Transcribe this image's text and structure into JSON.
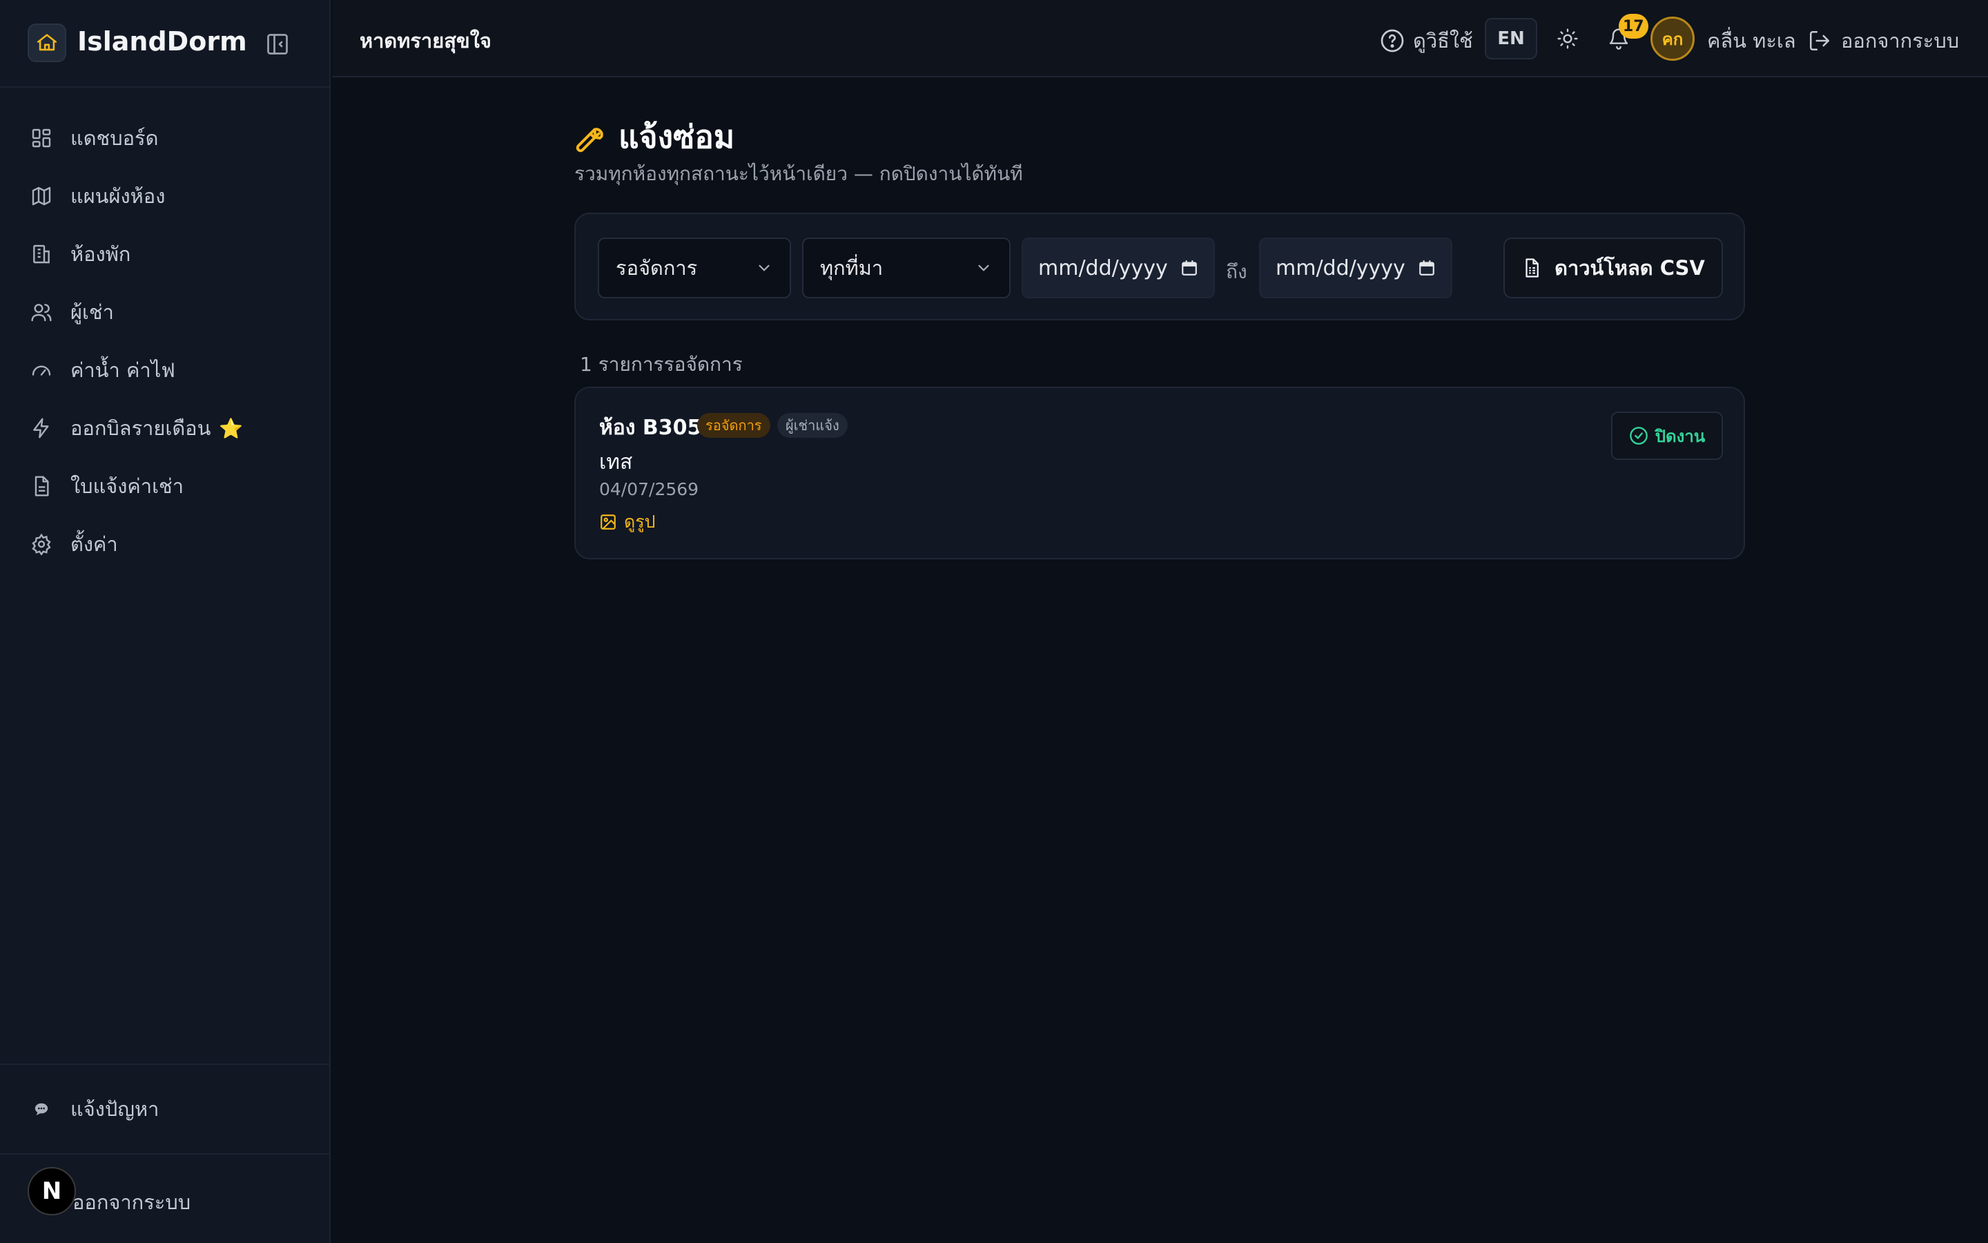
{
  "brand": {
    "name": "IslandDorm"
  },
  "sidebar": {
    "items": [
      {
        "label": "แดชบอร์ด",
        "icon": "dashboard-icon"
      },
      {
        "label": "แผนผังห้อง",
        "icon": "map-icon"
      },
      {
        "label": "ห้องพัก",
        "icon": "building-icon"
      },
      {
        "label": "ผู้เช่า",
        "icon": "users-icon"
      },
      {
        "label": "ค่าน้ำ ค่าไฟ",
        "icon": "gauge-icon"
      },
      {
        "label": "ออกบิลรายเดือน",
        "icon": "bolt-icon",
        "star": "⭐"
      },
      {
        "label": "ใบแจ้งค่าเช่า",
        "icon": "document-icon"
      },
      {
        "label": "ตั้งค่า",
        "icon": "gear-icon"
      }
    ],
    "report_label": "แจ้งปัญหา",
    "logout_label": "ออกจากระบบ",
    "nextjs_badge": "N"
  },
  "topbar": {
    "dorm_name": "หาดทรายสุขใจ",
    "help_label": "ดูวิธีใช้",
    "lang": "EN",
    "notifications": "17",
    "avatar_initials": "คก",
    "user_name": "คลื่น ทะเล",
    "logout_label": "ออกจากระบบ"
  },
  "page": {
    "title": "แจ้งซ่อม",
    "subtitle": "รวมทุกห้องทุกสถานะไว้หน้าเดียว — กดปิดงานได้ทันที"
  },
  "filters": {
    "status_value": "รอจัดการ",
    "source_value": "ทุกที่มา",
    "date_from": "mm/dd/yyyy",
    "to_label": "ถึง",
    "date_to": "mm/dd/yyyy",
    "csv_label": "ดาวน์โหลด CSV"
  },
  "results": {
    "count_label": "1 รายการรอจัดการ",
    "items": [
      {
        "room": "ห้อง B305",
        "status": "รอจัดการ",
        "source": "ผู้เช่าแจ้ง",
        "title": "เทส",
        "date": "04/07/2569",
        "photo_label": "ดูรูป",
        "close_label": "ปิดงาน"
      }
    ]
  },
  "colors": {
    "accent": "#f5b71a",
    "success": "#34d399",
    "background": "#0b0f17",
    "sidebar": "#111723"
  }
}
